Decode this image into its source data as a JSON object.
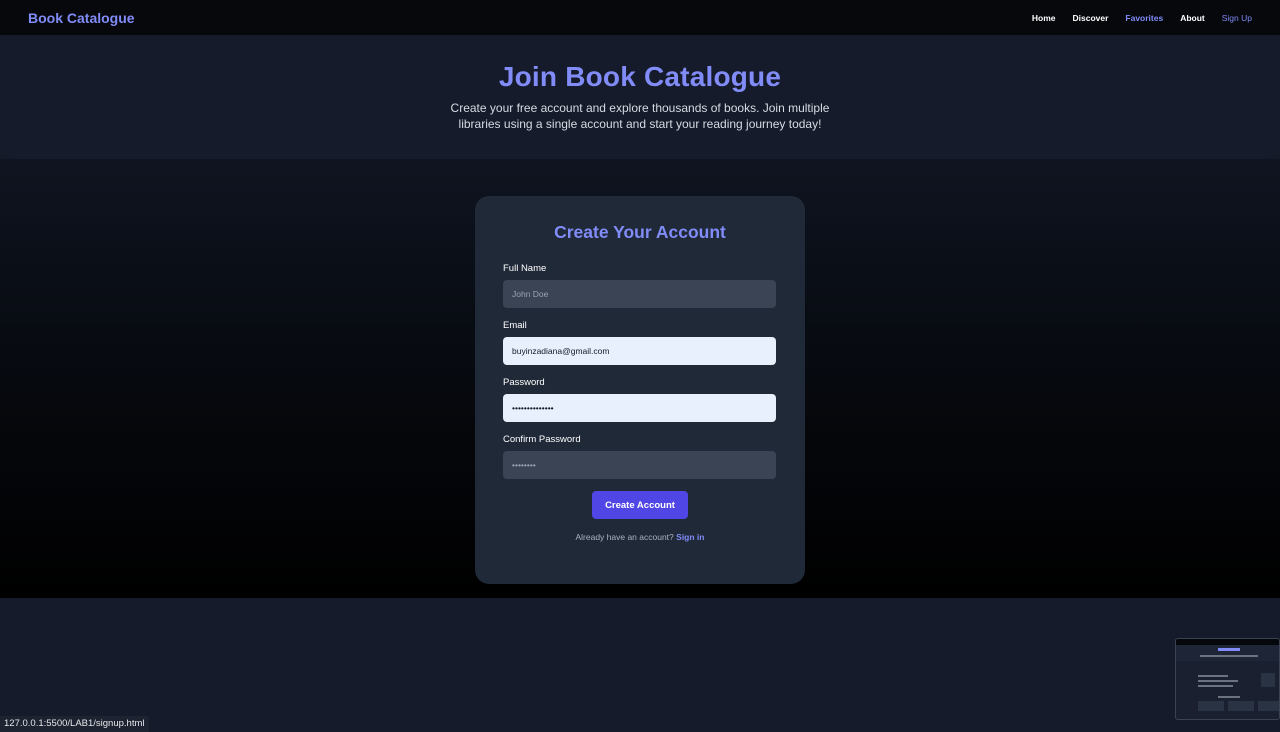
{
  "nav": {
    "brand": "Book Catalogue",
    "links": [
      "Home",
      "Discover",
      "Favorites",
      "About",
      "Sign Up"
    ],
    "active": "Favorites"
  },
  "hero": {
    "title": "Join Book Catalogue",
    "subtitle": "Create your free account and explore thousands of books. Join multiple libraries using a single account and start your reading journey today!"
  },
  "form": {
    "heading": "Create Your Account",
    "fields": [
      {
        "label": "Full Name",
        "value": "",
        "placeholder": "John Doe",
        "type": "text"
      },
      {
        "label": "Email",
        "value": "buyinzadiana@gmail.com",
        "placeholder": "",
        "type": "email"
      },
      {
        "label": "Password",
        "value": "••••••••••••••",
        "placeholder": "",
        "type": "text"
      },
      {
        "label": "Confirm Password",
        "value": "",
        "placeholder": "••••••••",
        "type": "text"
      }
    ],
    "submit_label": "Create Account",
    "signin_prompt": "Already have an account?",
    "signin_link": "Sign in"
  },
  "status_bar": {
    "url": "127.0.0.1:5500/LAB1/signup.html"
  },
  "colors": {
    "accent": "#818cf8",
    "button": "#4f46e5",
    "card": "#202938",
    "page_bg": "#141a28"
  }
}
